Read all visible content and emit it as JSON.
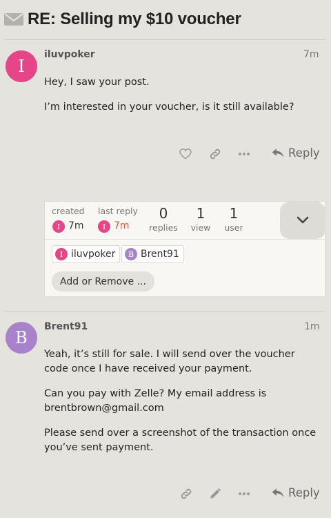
{
  "topic": {
    "title": "RE: Selling my $10 voucher"
  },
  "posts": [
    {
      "avatar_letter": "I",
      "avatar_color": "#e64587",
      "username": "iluvpoker",
      "time": "7m",
      "paragraphs": [
        "Hey, I saw your post.",
        "I’m interested in your voucher, is it still available?"
      ],
      "actions": {
        "like_icon": "heart-icon",
        "link_icon": "link-icon",
        "more_icon": "more-icon",
        "reply_label": "Reply"
      }
    },
    {
      "avatar_letter": "B",
      "avatar_color": "#a883cc",
      "username": "Brent91",
      "time": "1m",
      "paragraphs": [
        "Yeah, it’s still for sale. I will send over the voucher code once I have received your payment.",
        "Can you pay with Zelle? My email address is brentbrown@gmail.com",
        "Please send over a screenshot of the transaction once you’ve sent payment."
      ],
      "actions": {
        "link_icon": "link-icon",
        "edit_icon": "pencil-icon",
        "more_icon": "more-icon",
        "reply_label": "Reply"
      }
    }
  ],
  "summary": {
    "created_label": "created",
    "created_time": "7m",
    "last_reply_label": "last reply",
    "last_reply_time": "7m",
    "last_reply_color": "#e45735",
    "replies_count": "0",
    "replies_label": "replies",
    "views_count": "1",
    "views_label": "view",
    "users_count": "1",
    "users_label": "user",
    "participants": [
      {
        "letter": "I",
        "name": "iluvpoker",
        "color": "#e64587"
      },
      {
        "letter": "B",
        "name": "Brent91",
        "color": "#a883cc"
      }
    ],
    "add_remove_label": "Add or Remove ..."
  }
}
